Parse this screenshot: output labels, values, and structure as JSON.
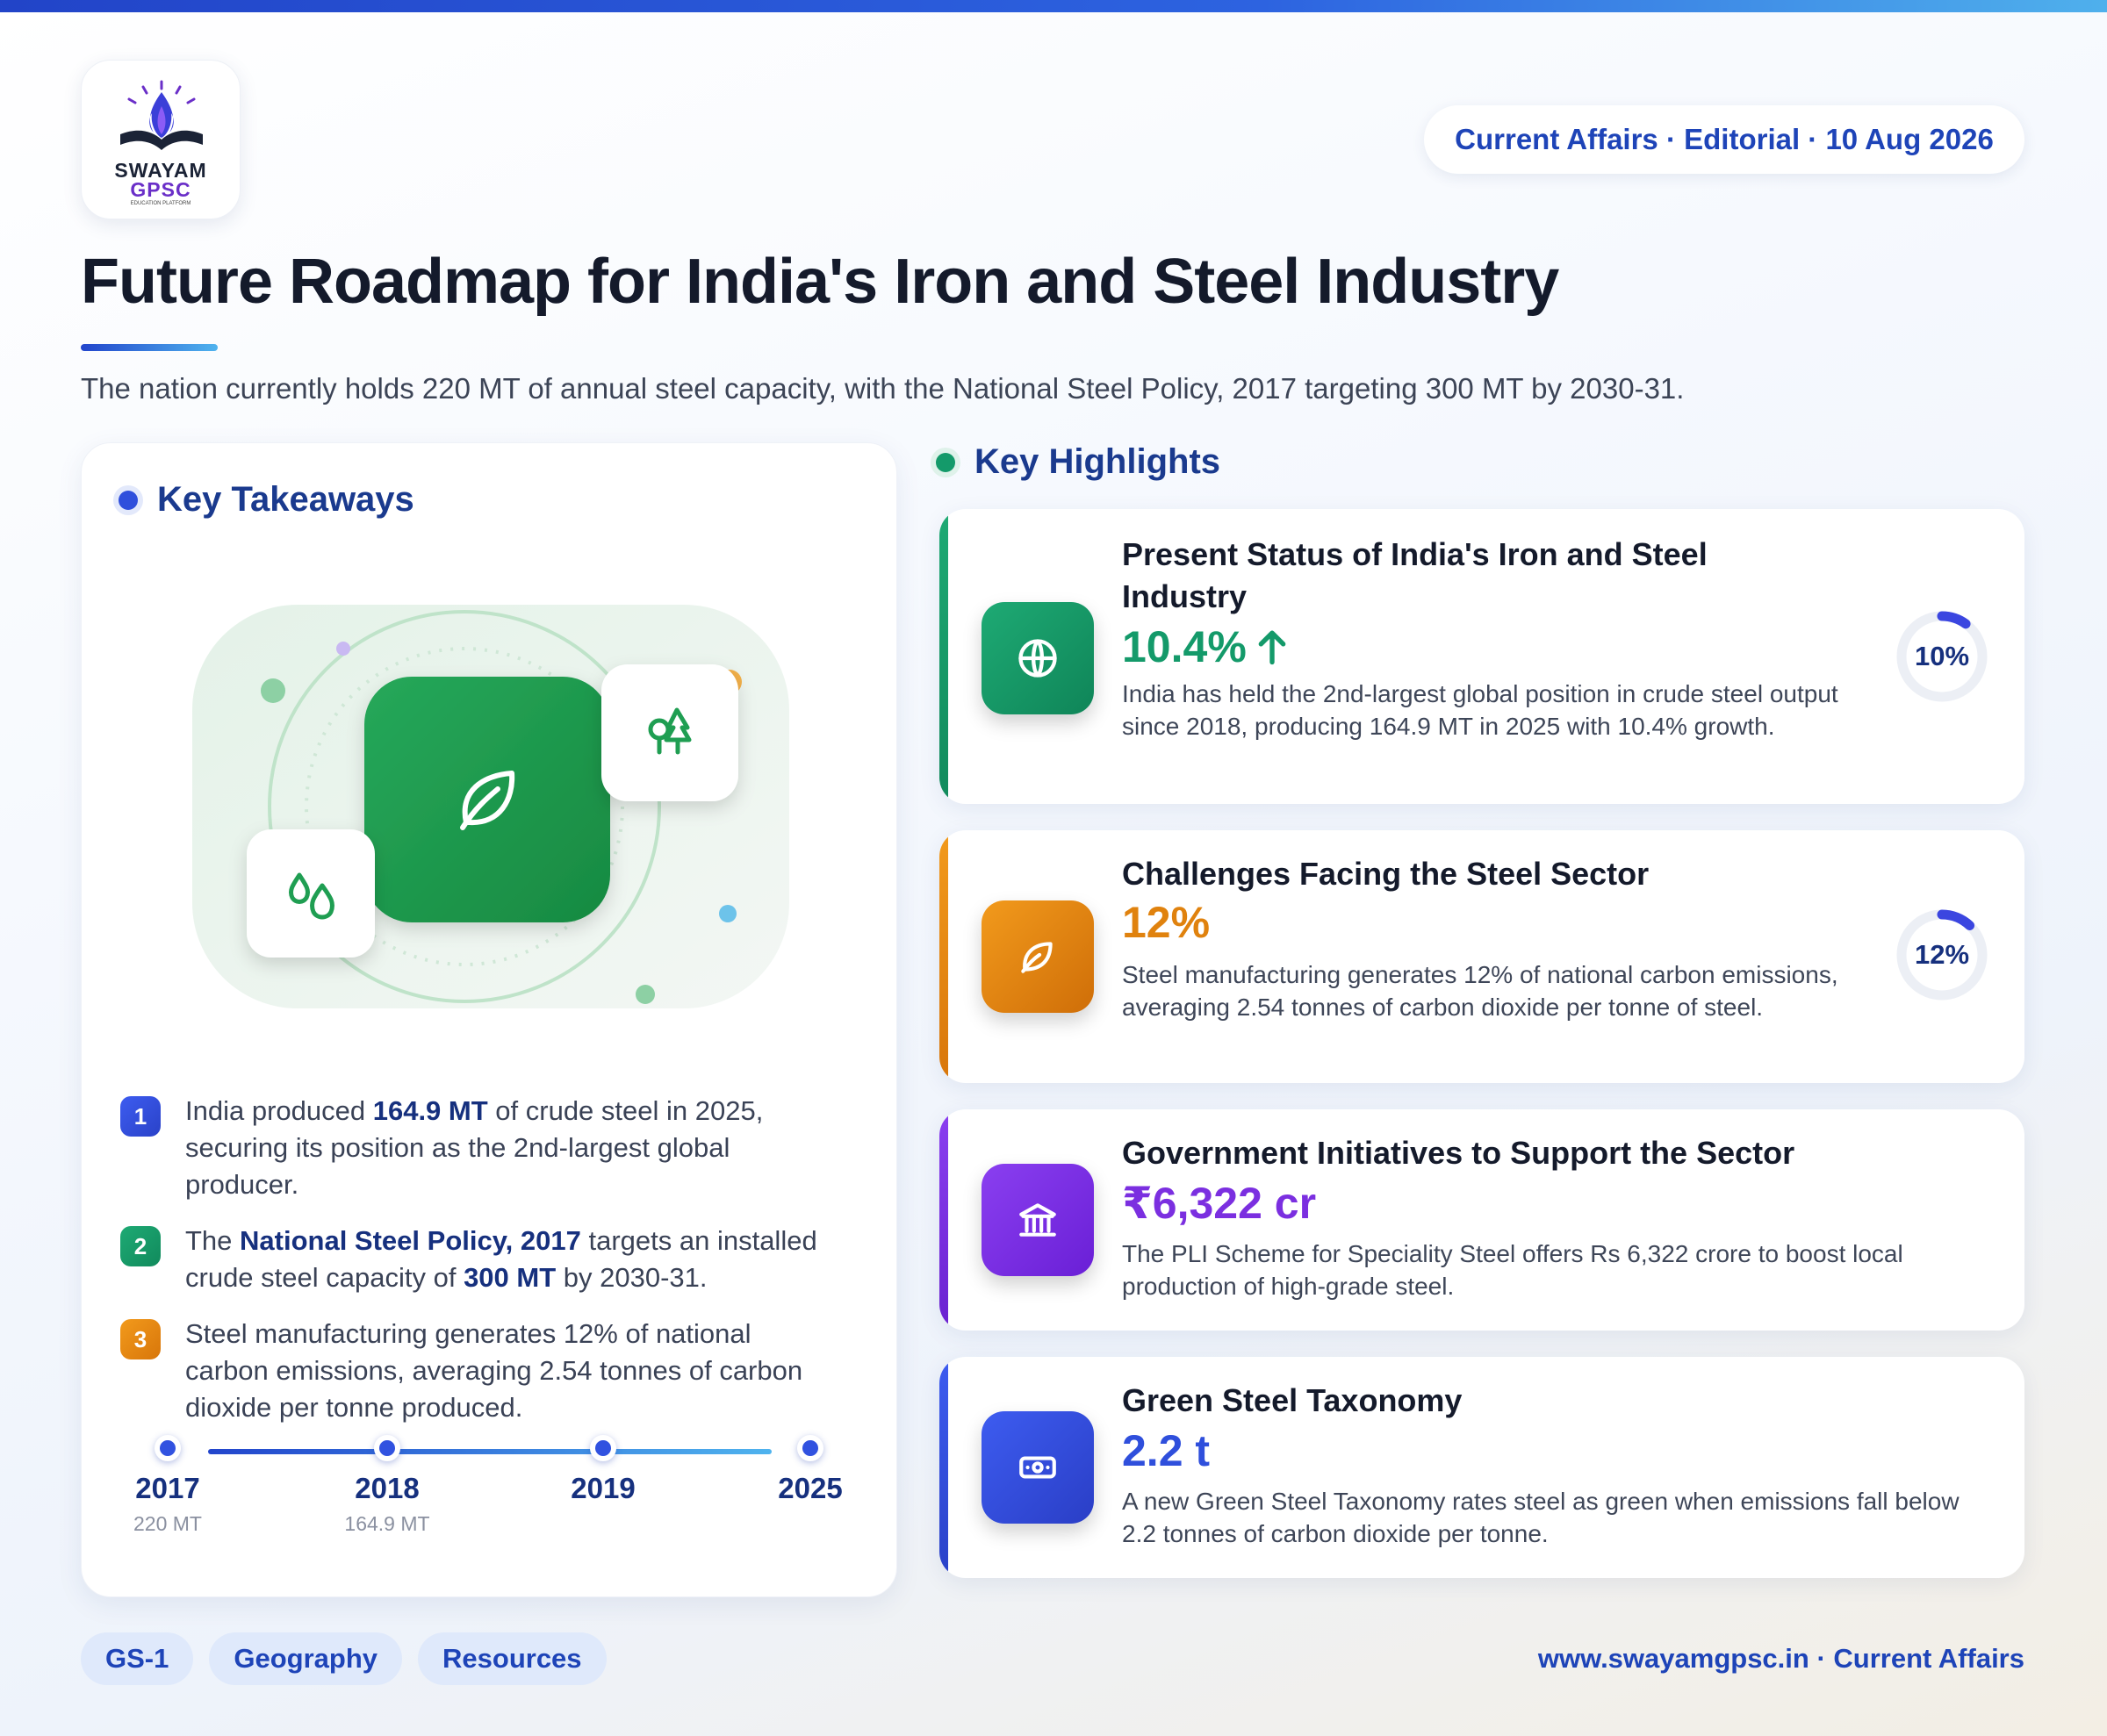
{
  "brand": {
    "name_line1": "SWAYAM",
    "name_line2": "GPSC",
    "tagline": "EDUCATION PLATFORM"
  },
  "header_pill": "Current Affairs · Editorial · 10 Aug 2026",
  "title": "Future Roadmap for India's Iron and Steel Industry",
  "subtitle": "The nation currently holds 220 MT of annual steel capacity, with the National Steel Policy, 2017 targeting 300 MT by 2030-31.",
  "colors": {
    "blue": "#2f4fdc",
    "green": "#149a6a",
    "orange": "#e78a10",
    "purple": "#7b2fe0",
    "navy": "#16307e"
  },
  "takeaways": {
    "heading": "Key Takeaways",
    "items": [
      {
        "num": "1",
        "pre": "India produced ",
        "bold": "164.9 MT",
        "post": " of crude steel in 2025, securing its position as the 2nd-largest global producer."
      },
      {
        "num": "2",
        "pre": "The ",
        "bold": "National Steel Policy, 2017",
        "mid": " targets an installed crude steel capacity of ",
        "bold2": "300 MT",
        "post": " by 2030-31."
      },
      {
        "num": "3",
        "pre": "Steel manufacturing generates 12% of national carbon emissions, averaging 2.54 tonnes of carbon dioxide per tonne produced."
      }
    ],
    "timeline": [
      {
        "year": "2017",
        "value": "220 MT"
      },
      {
        "year": "2018",
        "value": "164.9 MT"
      },
      {
        "year": "2019",
        "value": ""
      },
      {
        "year": "2025",
        "value": ""
      }
    ],
    "illustration_icons": [
      "leaf-icon",
      "trees-icon",
      "droplets-icon"
    ]
  },
  "highlights": {
    "heading": "Key Highlights",
    "items": [
      {
        "title": "Present Status of India's Iron and Steel Industry",
        "value": "10.4%",
        "trend": "up",
        "desc": "India has held the 2nd-largest global position in crude steel output since 2018, producing 164.9 MT in 2025 with 10.4% growth.",
        "ring_label": "10%",
        "ring_fraction": 0.1,
        "icon": "globe-icon"
      },
      {
        "title": "Challenges Facing the Steel Sector",
        "value": "12%",
        "desc": "Steel manufacturing generates 12% of national carbon emissions, averaging 2.54 tonnes of carbon dioxide per tonne of steel.",
        "ring_label": "12%",
        "ring_fraction": 0.12,
        "icon": "leaf-icon"
      },
      {
        "title": "Government Initiatives to Support the Sector",
        "value": "₹6,322 cr",
        "desc": "The PLI Scheme for Speciality Steel offers Rs 6,322 crore to boost local production of high-grade steel.",
        "icon": "bank-icon"
      },
      {
        "title": "Green Steel Taxonomy",
        "value": "2.2 t",
        "desc": "A new Green Steel Taxonomy rates steel as green when emissions fall below 2.2 tonnes of carbon dioxide per tonne.",
        "icon": "banknote-icon"
      }
    ]
  },
  "tags": [
    "GS-1",
    "Geography",
    "Resources"
  ],
  "footer": "www.swayamgpsc.in · Current Affairs"
}
